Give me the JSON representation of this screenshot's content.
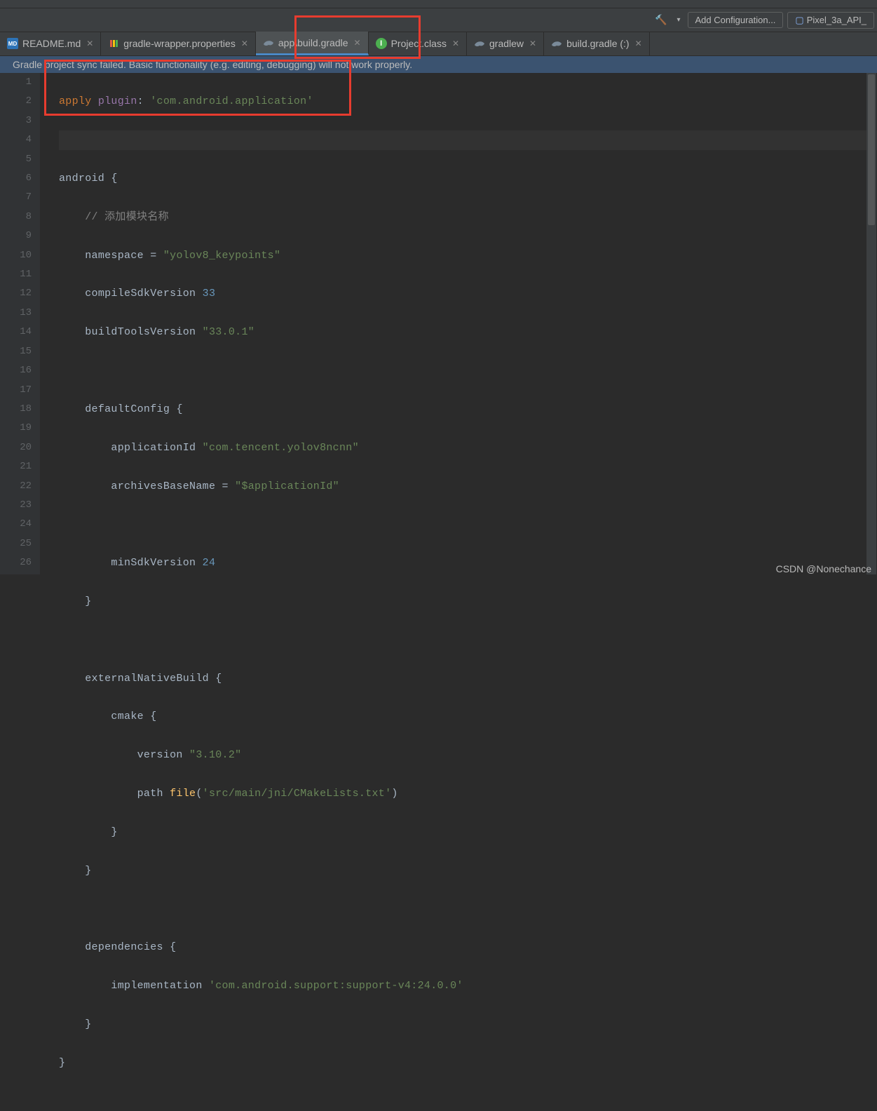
{
  "toolbar": {
    "config_label": "Add Configuration...",
    "device_label": "Pixel_3a_API_",
    "hammer_icon": "build-icon",
    "dropdown_icon": "dropdown-icon"
  },
  "tabs": [
    {
      "icon": "md",
      "label": "README.md",
      "closable": true,
      "active": false
    },
    {
      "icon": "props",
      "label": "gradle-wrapper.properties",
      "closable": true,
      "active": false
    },
    {
      "icon": "gradle",
      "label": "app\\build.gradle",
      "closable": true,
      "active": true
    },
    {
      "icon": "java",
      "label": "Project.class",
      "closable": true,
      "active": false
    },
    {
      "icon": "gradle",
      "label": "gradlew",
      "closable": true,
      "active": false
    },
    {
      "icon": "gradle",
      "label": "build.gradle (:)",
      "closable": true,
      "active": false
    }
  ],
  "status": {
    "message": "Gradle project sync failed. Basic functionality (e.g. editing, debugging) will not work properly."
  },
  "code": {
    "line_count": 26,
    "tokens": {
      "l1_apply": "apply",
      "l1_plugin": "plugin",
      "l1_colon": ": ",
      "l1_str": "'com.android.application'",
      "l3_android": "android {",
      "l4_cmt": "// 添加模块名称",
      "l5_ns": "namespace = ",
      "l5_str": "\"yolov8_keypoints\"",
      "l6_csv": "compileSdkVersion ",
      "l6_num": "33",
      "l7_btv": "buildToolsVersion ",
      "l7_str": "\"33.0.1\"",
      "l9_dc": "defaultConfig {",
      "l10_appid": "applicationId ",
      "l10_str": "\"com.tencent.yolov8ncnn\"",
      "l11_abn": "archivesBaseName = ",
      "l11_str": "\"$applicationId\"",
      "l13_msv": "minSdkVersion ",
      "l13_num": "24",
      "l14_cb": "}",
      "l16_enb": "externalNativeBuild {",
      "l17_cmake": "cmake {",
      "l18_ver": "version ",
      "l18_str": "\"3.10.2\"",
      "l19_path": "path ",
      "l19_fn": "file",
      "l19_op": "(",
      "l19_str": "'src/main/jni/CMakeLists.txt'",
      "l19_cp": ")",
      "l20_cb": "}",
      "l21_cb": "}",
      "l23_dep": "dependencies {",
      "l24_impl": "implementation ",
      "l24_str": "'com.android.support:support-v4:24.0.0'",
      "l25_cb": "}",
      "l26_cb": "}"
    }
  },
  "watermark": "CSDN @Nonechance"
}
